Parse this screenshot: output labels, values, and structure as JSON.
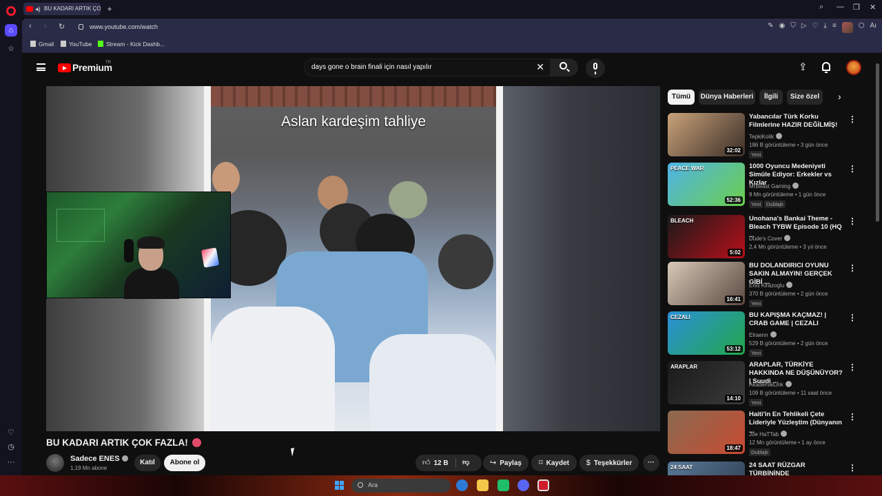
{
  "browser": {
    "tab_title": "BU KADARI ARTIK ÇO",
    "url": "www.youtube.com/watch",
    "bookmarks": [
      "Gmail",
      "YouTube",
      "Stream - Kick Dashb..."
    ]
  },
  "header": {
    "logo_text": "Premium",
    "logo_country": "TR",
    "search_value": "days gone o brain finali için nasıl yapılır"
  },
  "video": {
    "caption": "Aslan kardeşim tahliye",
    "title": "BU KADARI ARTIK ÇOK FAZLA!",
    "channel_name": "Sadece ENES",
    "subscribers": "1,19 Mn abone",
    "join_label": "Katıl",
    "subscribe_label": "Abone ol",
    "like_count": "12 B",
    "share_label": "Paylaş",
    "save_label": "Kaydet",
    "thanks_label": "Teşekkürler"
  },
  "chips": [
    "Tümü",
    "Dünya Haberleri",
    "İlgili",
    "Size özel"
  ],
  "recommendations": [
    {
      "title": "Yabancılar Türk Korku Filmlerine HAZIR DEĞİLMİŞ!",
      "channel": "TepkiKolik",
      "meta": "186 B görüntüleme • 3 gün önce",
      "badge": "Yeni",
      "badge2": "",
      "duration": "32:02",
      "thumb_text": "",
      "color1": "#c9a27a",
      "color2": "#3a2e28"
    },
    {
      "title": "1000 Oyuncu Medeniyeti Simüle Ediyor: Erkekler vs Kızlar",
      "channel": "MrBeast Gaming",
      "meta": "9 Mn görüntüleme • 1 gün önce",
      "badge": "Yeni",
      "badge2": "Dublajlı",
      "duration": "52:36",
      "thumb_text": "PEACE      WAR",
      "color1": "#4fb3e8",
      "color2": "#6bcf4a"
    },
    {
      "title": "Unohana's Bankai Theme - Bleach TYBW Episode 10 (HQ ...",
      "channel": "Dude's Cover",
      "meta": "2,4 Mn görüntüleme • 3 yıl önce",
      "badge": "",
      "badge2": "",
      "duration": "5:02",
      "thumb_text": "BLEACH",
      "color1": "#1a1a1a",
      "color2": "#b8101a"
    },
    {
      "title": "BU DOLANDIRICI OYUNU SAKIN ALMAYIN! GERÇEK GİBİ ...",
      "channel": "Enis Kirazoglu",
      "meta": "370 B görüntüleme • 2 gün önce",
      "badge": "Yeni",
      "badge2": "",
      "duration": "16:41",
      "thumb_text": "",
      "color1": "#d8c8b8",
      "color2": "#5a4a40"
    },
    {
      "title": "BU KAPIŞMA KAÇMAZ! | CRAB GAME | CEZALI",
      "channel": "Elraenn",
      "meta": "529 B görüntüleme • 2 gün önce",
      "badge": "Yeni",
      "badge2": "",
      "duration": "53:12",
      "thumb_text": "CEZALI",
      "color1": "#2b8fd8",
      "color2": "#22a84a"
    },
    {
      "title": "ARAPLAR, TÜRKİYE HAKKINDA NE DÜŞÜNÜYOR? | Suudi ...",
      "channel": "AkademikLink",
      "meta": "109 B görüntüleme • 11 saat önce",
      "badge": "Yeni",
      "badge2": "",
      "duration": "14:10",
      "thumb_text": "ARAPLAR",
      "color1": "#1a1a1a",
      "color2": "#3a3a3a"
    },
    {
      "title": "Haiti'in En Tehlikeli Çete Lideriyle Yüzleştim (Dünyanın ...",
      "channel": "Joe HaTTab",
      "meta": "12 Mn görüntüleme • 1 ay önce",
      "badge": "",
      "badge2": "Dublajlı",
      "duration": "18:47",
      "thumb_text": "",
      "color1": "#8a6a50",
      "color2": "#c84a30"
    },
    {
      "title": "24 SAAT RÜZGAR TÜRBİNİNDE",
      "channel": "",
      "meta": "",
      "badge": "",
      "badge2": "",
      "duration": "",
      "thumb_text": "24 SAAT",
      "color1": "#5a7a9a",
      "color2": "#2a3a4a"
    }
  ],
  "taskbar": {
    "search_placeholder": "Ara"
  }
}
